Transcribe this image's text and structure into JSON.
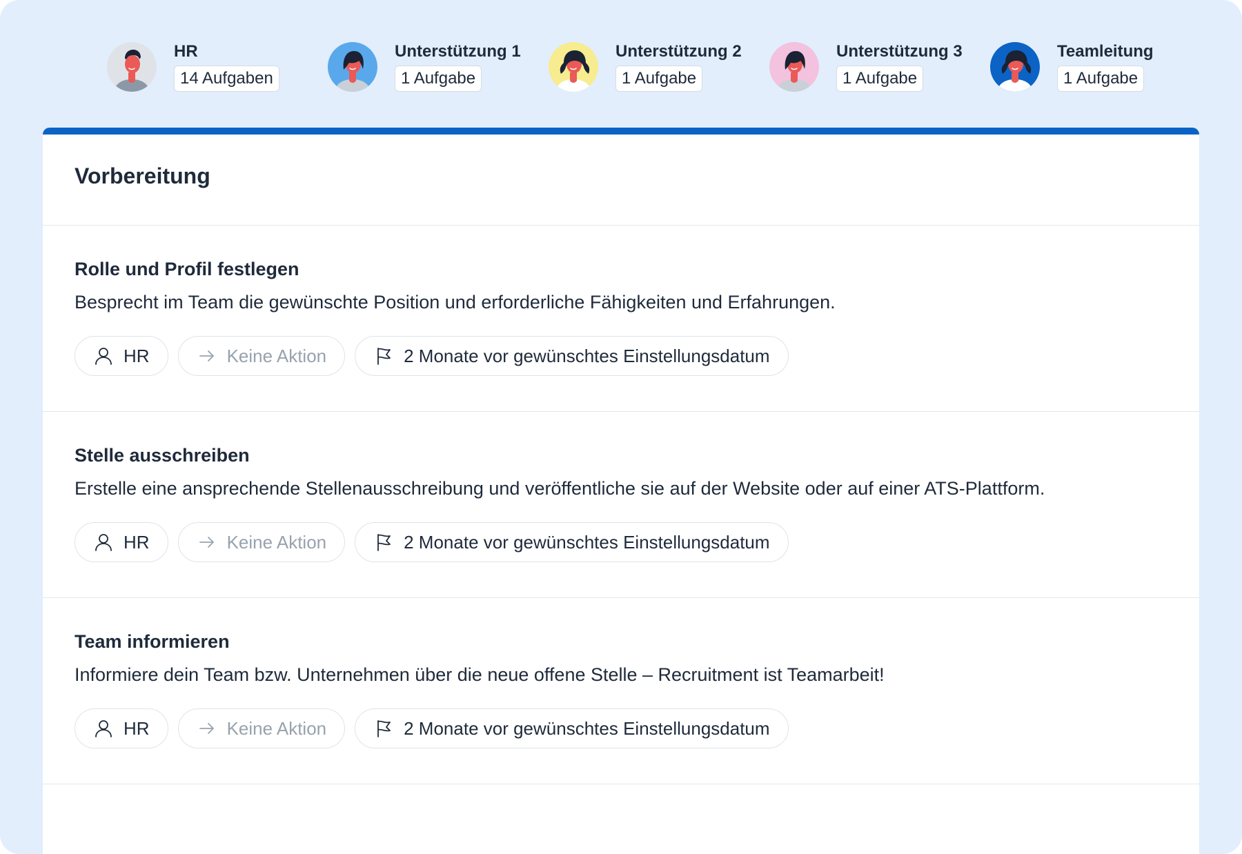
{
  "assignees": [
    {
      "name": "HR",
      "count": "14 Aufgaben",
      "avatar_bg": "#dfe3e8",
      "style": "man"
    },
    {
      "name": "Unterstützung 1",
      "count": "1 Aufgabe",
      "avatar_bg": "#5aa8ec",
      "style": "woman"
    },
    {
      "name": "Unterstützung 2",
      "count": "1 Aufgabe",
      "avatar_bg": "#f7ec8f",
      "style": "woman-curly"
    },
    {
      "name": "Unterstützung 3",
      "count": "1 Aufgabe",
      "avatar_bg": "#f3c2de",
      "style": "woman"
    },
    {
      "name": "Teamleitung",
      "count": "1 Aufgabe",
      "avatar_bg": "#0b63c5",
      "style": "woman-curly"
    }
  ],
  "section": {
    "title": "Vorbereitung"
  },
  "tasks": [
    {
      "title": "Rolle und Profil festlegen",
      "description": "Besprecht im Team die gewünschte Position und erforderliche Fähigkeiten und Erfahrungen.",
      "assignee": "HR",
      "action": "Keine Aktion",
      "deadline": "2 Monate vor gewünschtes Einstellungsdatum"
    },
    {
      "title": "Stelle ausschreiben",
      "description": "Erstelle eine ansprechende Stellenausschreibung und veröffentliche sie auf der Website oder auf einer ATS-Plattform.",
      "assignee": "HR",
      "action": "Keine Aktion",
      "deadline": "2 Monate vor gewünschtes Einstellungsdatum"
    },
    {
      "title": "Team informieren",
      "description": "Informiere dein Team bzw. Unternehmen über die neue offene Stelle – Recruitment ist Teamarbeit!",
      "assignee": "HR",
      "action": "Keine Aktion",
      "deadline": "2 Monate vor gewünschtes Einstellungsdatum"
    }
  ],
  "icons": {
    "assignee": "user-icon",
    "action": "arrow-right-icon",
    "deadline": "flag-icon"
  },
  "colors": {
    "accent": "#0b63c5",
    "background": "#e2eefc",
    "skin": "#ea5a57",
    "hair": "#1a2233",
    "muted_text": "#98a2ad"
  }
}
